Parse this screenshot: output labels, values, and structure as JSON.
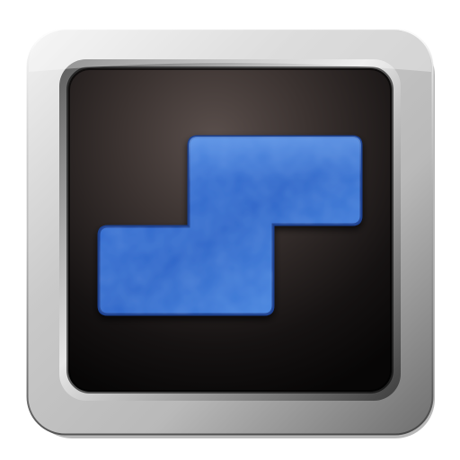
{
  "icon": {
    "name": "s-tetromino-app-icon",
    "glyph": "blue-s-tetromino",
    "colors": {
      "frame_light": "#f2f2f2",
      "frame_mid": "#b9b9b9",
      "frame_dark": "#6e6e6e",
      "inner_rim_light": "#d8d8d8",
      "inner_rim_dark": "#4a4a4a",
      "screen_center": "#4a403e",
      "screen_edge": "#0d0b0b",
      "block_light": "#4f8fe6",
      "block_mid": "#2f66c8",
      "block_dark": "#1c3f8e"
    }
  }
}
